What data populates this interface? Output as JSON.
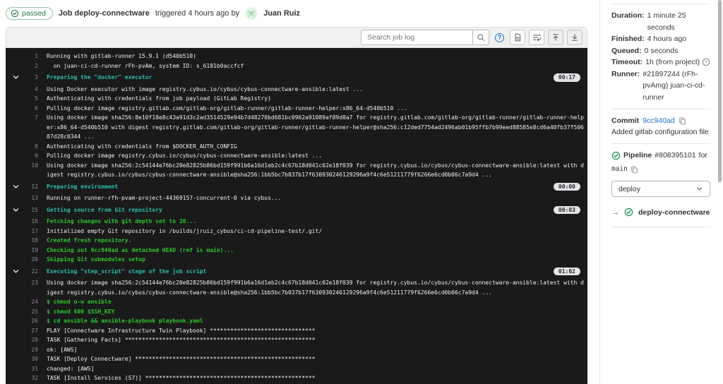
{
  "colors": {
    "accent_blue": "#1f75cb",
    "status_green": "#217645",
    "log_background": "#1a1a1a",
    "log_section_teal": "#2dbdb0",
    "log_green": "#2ec52e"
  },
  "header": {
    "status": "passed",
    "job_title": "Job deploy-connectware",
    "triggered": "triggered 4 hours ago by",
    "user": "Juan Ruiz"
  },
  "toolbar": {
    "search_placeholder": "Search job log"
  },
  "log": {
    "lines": [
      {
        "num": 1,
        "kind": "plain",
        "text": "Running with gitlab-runner 15.9.1 (d540b510)"
      },
      {
        "num": 2,
        "kind": "plain",
        "text": "  on juan-ci-cd-runner rFh-pvAm, system ID: s_6181b0accfcf"
      },
      {
        "num": 3,
        "kind": "section",
        "duration": "00:17",
        "text": "Preparing the \"docker\" executor"
      },
      {
        "num": 4,
        "kind": "plain",
        "text": "Using Docker executor with image registry.cybus.io/cybus/cybus-connectware-ansible:latest ..."
      },
      {
        "num": 5,
        "kind": "plain",
        "text": "Authenticating with credentials from job payload (GitLab Registry)"
      },
      {
        "num": 6,
        "kind": "plain",
        "text": "Pulling docker image registry.gitlab.com/gitlab-org/gitlab-runner/gitlab-runner-helper:x86_64-d540b510 ..."
      },
      {
        "num": 7,
        "kind": "plain",
        "text": "Using docker image sha256:8e10f18e8c43a91d3c2ad3514529e94b7d48270bd681bc0962a91089af89d0a7 for registry.gitlab.com/gitlab-org/gitlab-runner/gitlab-runner-helper:x86_64-d540b510 with digest registry.gitlab.com/gitlab-org/gitlab-runner/gitlab-runner-helper@sha256:c12ded7754ad2496ab01b95ffb7b99eed88585e8cd6a40fb37f50687d28c0344 ..."
      },
      {
        "num": 8,
        "kind": "plain",
        "text": "Authenticating with credentials from $DOCKER_AUTH_CONFIG"
      },
      {
        "num": 9,
        "kind": "plain",
        "text": "Pulling docker image registry.cybus.io/cybus/cybus-connectware-ansible:latest ..."
      },
      {
        "num": 10,
        "kind": "plain",
        "text": "Using docker image sha256:2c54144e76bc20e82825b86bd159f991b6a16d1eb2c4c67b18d041c02e18f039 for registry.cybus.io/cybus/cybus-connectware-ansible:latest with digest registry.cybus.io/cybus/cybus-connectware-ansible@sha256:1bb5bc7b037b17f630930246129296a9f4c6e51211779f6266e6cd0b06c7a9d4 ..."
      },
      {
        "num": 12,
        "kind": "section",
        "duration": "00:00",
        "text": "Preparing environment"
      },
      {
        "num": 13,
        "kind": "plain",
        "text": "Running on runner-rfh-pvam-project-44369157-concurrent-0 via cybus..."
      },
      {
        "num": 15,
        "kind": "section",
        "duration": "00:03",
        "text": "Getting source from Git repository"
      },
      {
        "num": 16,
        "kind": "green",
        "text": "Fetching changes with git depth set to 20..."
      },
      {
        "num": 17,
        "kind": "plain",
        "text": "Initialized empty Git repository in /builds/jruiz_cybus/ci-cd-pipeline-test/.git/"
      },
      {
        "num": 18,
        "kind": "green",
        "text": "Created fresh repository."
      },
      {
        "num": 19,
        "kind": "green",
        "text": "Checking out 9cc940ad as detached HEAD (ref is main)..."
      },
      {
        "num": 20,
        "kind": "green",
        "text": "Skipping Git submodules setup"
      },
      {
        "num": 22,
        "kind": "section",
        "duration": "01:02",
        "text": "Executing \"step_script\" stage of the job script"
      },
      {
        "num": 23,
        "kind": "plain",
        "text": "Using docker image sha256:2c54144e76bc20e82825b86bd159f991b6a16d1eb2c4c67b18d041c02e18f039 for registry.cybus.io/cybus/cybus-connectware-ansible:latest with digest registry.cybus.io/cybus/cybus-connectware-ansible@sha256:1bb5bc7b037b17f630930246129296a9f4c6e51211779f6266e6cd0b06c7a9d4 ..."
      },
      {
        "num": 24,
        "kind": "green",
        "text": "$ chmod o-w ansible"
      },
      {
        "num": 25,
        "kind": "green",
        "text": "$ chmod 600 $SSH_KEY"
      },
      {
        "num": 26,
        "kind": "green",
        "text": "$ cd ansible && ansible-playbook playbook.yaml"
      },
      {
        "num": 27,
        "kind": "plain",
        "text": "PLAY [Connectware Infrastructure Twin Playbook] *******************************"
      },
      {
        "num": 28,
        "kind": "plain",
        "text": "TASK [Gathering Facts] ********************************************************"
      },
      {
        "num": 29,
        "kind": "plain",
        "text": "ok: [AWS]"
      },
      {
        "num": 30,
        "kind": "plain",
        "text": "TASK [Deploy Connectware] *****************************************************"
      },
      {
        "num": 31,
        "kind": "plain",
        "text": "changed: [AWS]"
      },
      {
        "num": 32,
        "kind": "plain",
        "text": "TASK [Install Services (S7)] **************************************************"
      }
    ]
  },
  "sidebar": {
    "details": [
      {
        "label": "Duration:",
        "value": "1 minute 25 seconds"
      },
      {
        "label": "Finished:",
        "value": "4 hours ago"
      },
      {
        "label": "Queued:",
        "value": "0 seconds"
      },
      {
        "label": "Timeout:",
        "value": "1h (from project)",
        "help": true
      },
      {
        "label": "Runner:",
        "value": "#21897244 (rFh-pvAmg) juan-ci-cd-runner"
      }
    ],
    "commit": {
      "label": "Commit",
      "sha": "9cc940ad",
      "message": "Added gitlab configuration file"
    },
    "pipeline": {
      "label": "Pipeline",
      "id": "#808395101",
      "for_text": "for",
      "ref": "main"
    },
    "stage_dropdown": {
      "value": "deploy"
    },
    "jobs": [
      {
        "name": "deploy-connectware",
        "status": "passed"
      }
    ],
    "icons": {
      "arrow_right": "→"
    }
  }
}
